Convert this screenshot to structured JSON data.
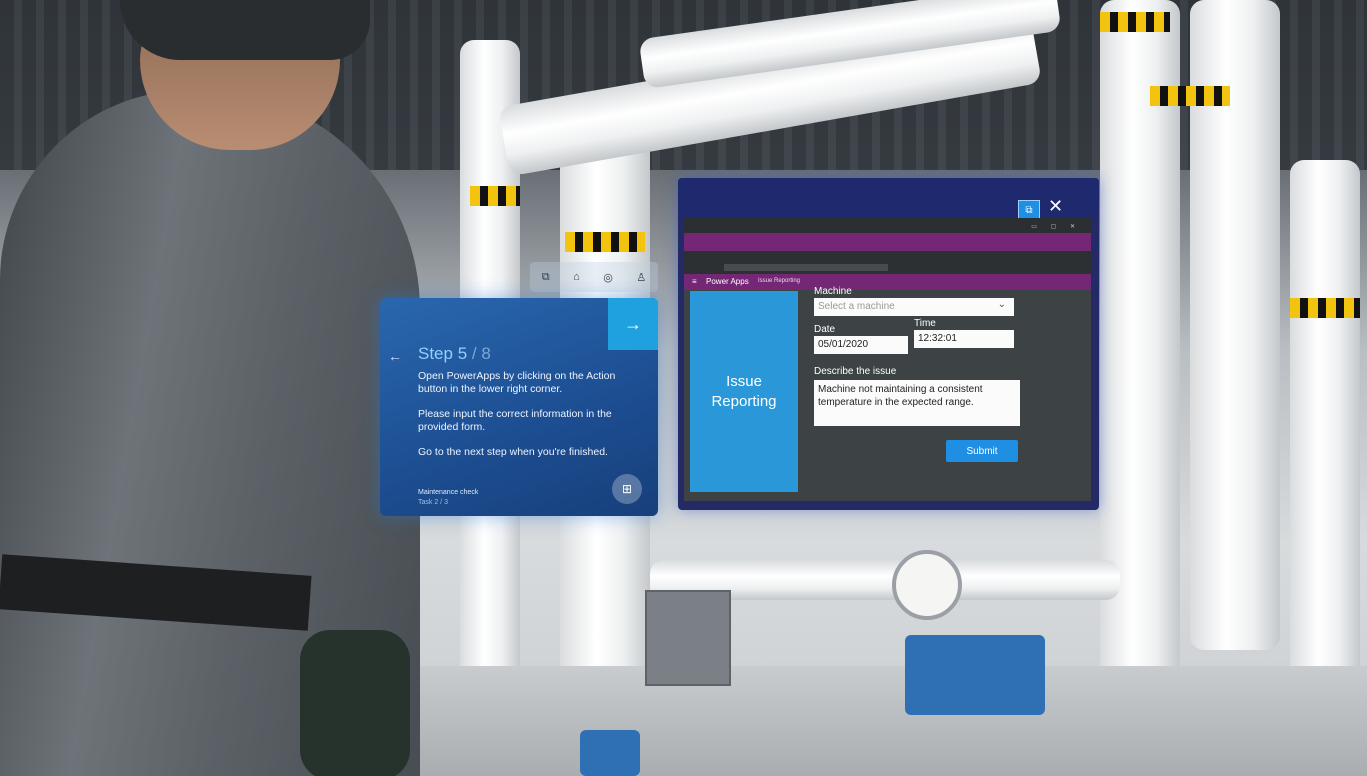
{
  "guide": {
    "step_label": "Step 5",
    "step_total": "/ 8",
    "instructions": [
      "Open PowerApps by clicking on the Action button in the lower right corner.",
      "Please input the correct information in the provided form.",
      "Go to the next step when you're finished."
    ],
    "task_name": "Maintenance check",
    "task_progress": "Task 2 / 3",
    "icons": {
      "next": "arrow-right-icon",
      "back": "arrow-left-icon",
      "action": "app-action-icon"
    }
  },
  "window": {
    "accent": "#742774",
    "sidebar_color": "#2a98d8",
    "button_color": "#1f8fe4",
    "app": {
      "brand": "Power Apps",
      "breadcrumb": "Issue Reporting"
    },
    "sidebar": {
      "title_line1": "Issue",
      "title_line2": "Reporting"
    },
    "form": {
      "machine_label": "Machine",
      "machine_placeholder": "Select a machine",
      "date_label": "Date",
      "date_value": "05/01/2020",
      "time_label": "Time",
      "time_value": "12:32:01",
      "issue_label": "Describe the issue",
      "issue_value": "Machine not maintaining a consistent temperature in the expected range.",
      "submit_label": "Submit"
    }
  }
}
